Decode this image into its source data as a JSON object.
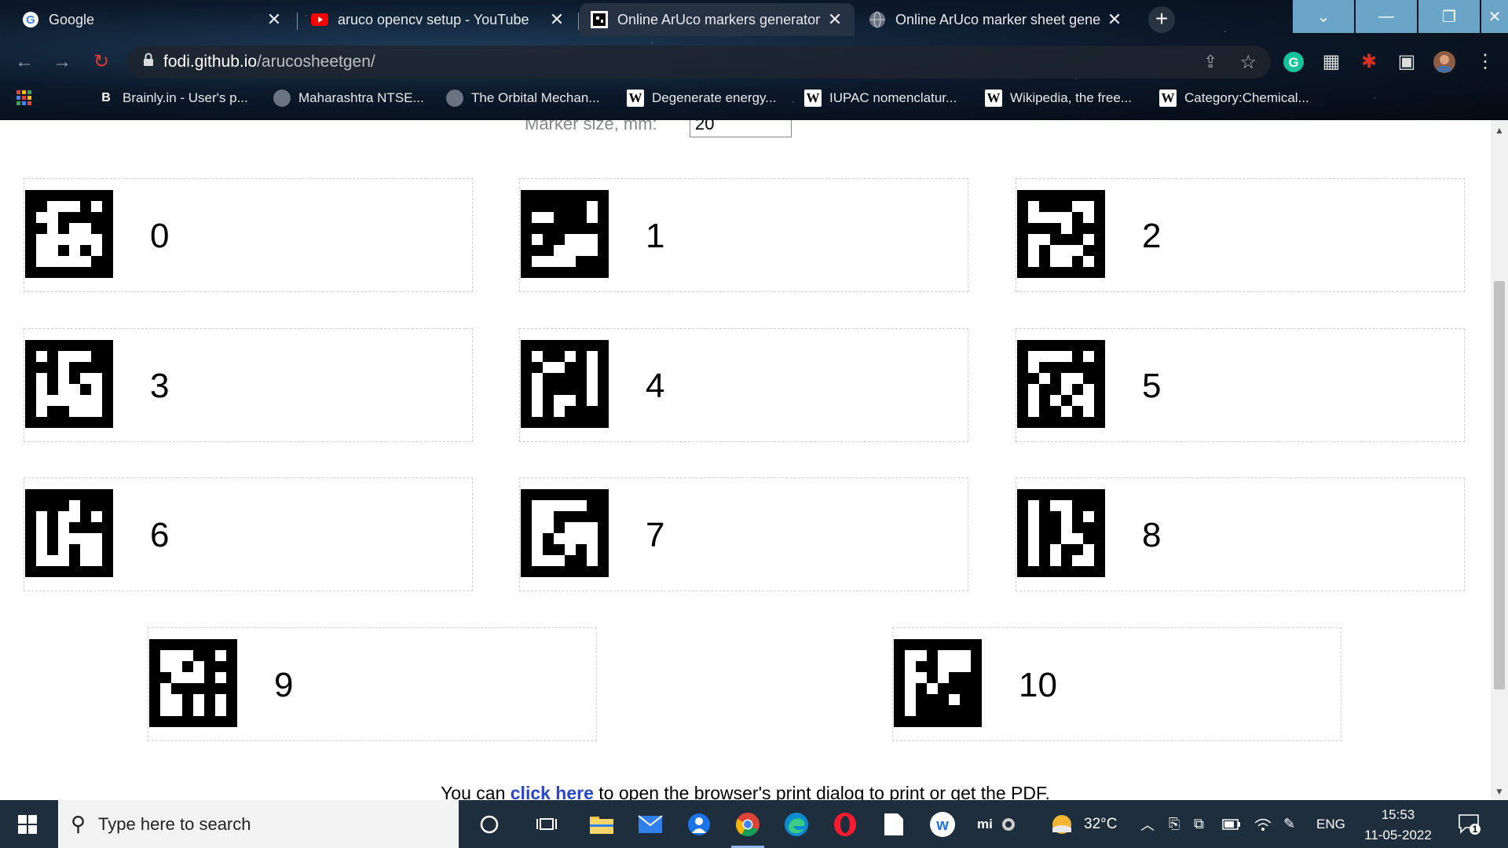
{
  "browser": {
    "tabs": [
      {
        "title": "Google",
        "icon": "google-icon",
        "active": false
      },
      {
        "title": "aruco opencv setup - YouTube",
        "icon": "youtube-icon",
        "active": false
      },
      {
        "title": "Online ArUco markers generator",
        "icon": "aruco-icon",
        "active": true
      },
      {
        "title": "Online ArUco marker sheet gene",
        "icon": "globe-icon",
        "active": false
      }
    ],
    "new_tab": "+",
    "url_host": "fodi.github.io",
    "url_path": "/arucosheetgen/",
    "bookmarks": [
      {
        "label": "Brainly.in - User's p...",
        "icon": "brainly-icon"
      },
      {
        "label": "Maharashtra NTSE...",
        "icon": "globe-icon"
      },
      {
        "label": "The Orbital Mechan...",
        "icon": "globe-icon"
      },
      {
        "label": "Degenerate energy...",
        "icon": "wikipedia-icon"
      },
      {
        "label": "IUPAC nomenclatur...",
        "icon": "wikipedia-icon"
      },
      {
        "label": "Wikipedia, the free...",
        "icon": "wikipedia-icon"
      },
      {
        "label": "Category:Chemical...",
        "icon": "wikipedia-icon"
      }
    ]
  },
  "page": {
    "marker_size_label": "Marker size, mm:",
    "marker_size_value": "20",
    "markers": [
      {
        "id": "0",
        "grid": [
          "00000000",
          "00111010",
          "01100000",
          "00101100",
          "01111110",
          "01101010",
          "01111100",
          "00000000"
        ]
      },
      {
        "id": "1",
        "grid": [
          "00000000",
          "00000010",
          "01100010",
          "00000000",
          "01001110",
          "00011110",
          "01111000",
          "00000000"
        ]
      },
      {
        "id": "2",
        "grid": [
          "00000000",
          "01000110",
          "01111010",
          "00001000",
          "01100010",
          "01011100",
          "01011010",
          "00000000"
        ]
      },
      {
        "id": "3",
        "grid": [
          "00000000",
          "01011100",
          "00010000",
          "01010110",
          "01011010",
          "01111110",
          "01001110",
          "00000000"
        ]
      },
      {
        "id": "4",
        "grid": [
          "00000000",
          "01001010",
          "00110010",
          "01000010",
          "01000010",
          "01011010",
          "01010000",
          "00000000"
        ]
      },
      {
        "id": "5",
        "grid": [
          "00000000",
          "01111010",
          "01000000",
          "00101100",
          "01001010",
          "01010110",
          "01001010",
          "00000000"
        ]
      },
      {
        "id": "6",
        "grid": [
          "00000000",
          "00001000",
          "01011010",
          "01010000",
          "01011110",
          "01010110",
          "01110110",
          "00000000"
        ]
      },
      {
        "id": "7",
        "grid": [
          "00000000",
          "01111100",
          "01100000",
          "01101110",
          "01011110",
          "01001010",
          "01110010",
          "00000000"
        ]
      },
      {
        "id": "8",
        "grid": [
          "00000000",
          "01011000",
          "01001010",
          "01001000",
          "01001100",
          "01010010",
          "01010110",
          "00000000"
        ]
      },
      {
        "id": "9",
        "grid": [
          "00000000",
          "01110010",
          "01101000",
          "00111010",
          "01000000",
          "01101010",
          "01101010",
          "00000000"
        ]
      },
      {
        "id": "10",
        "grid": [
          "00000000",
          "01101110",
          "01001110",
          "01101000",
          "01010000",
          "01000100",
          "01000000",
          "00000000"
        ]
      }
    ],
    "print_prefix": "You can ",
    "print_link": "click here",
    "print_suffix": " to open the browser's print dialog to print or get the PDF."
  },
  "taskbar": {
    "search_placeholder": "Type here to search",
    "weather": "32°C",
    "language": "ENG",
    "time": "15:53",
    "date": "11-05-2022",
    "notifications": "1",
    "mi_label": "mi"
  },
  "colors": {
    "link": "#2647c8",
    "taskbar": "#1f2e3d",
    "window_buttons": "#6aa4c6"
  }
}
